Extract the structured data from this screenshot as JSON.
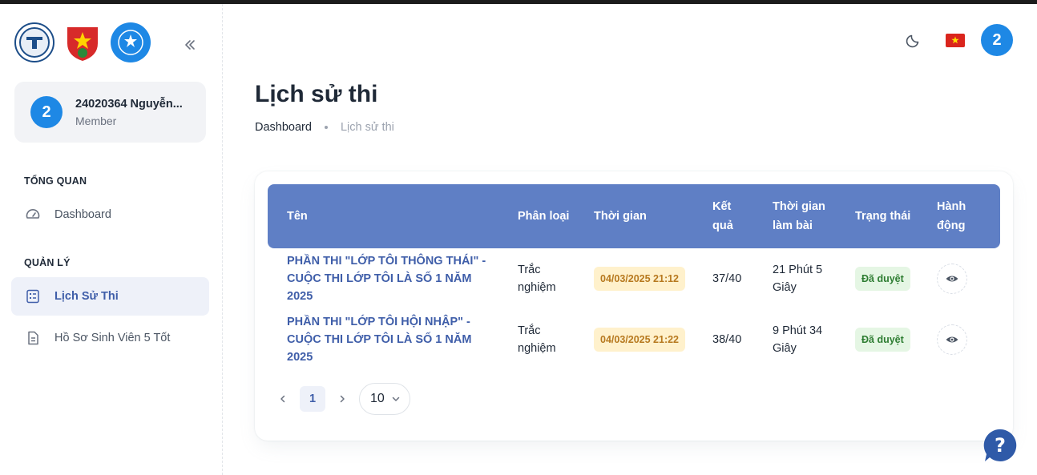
{
  "sidebar": {
    "user": {
      "avatar_letter": "2",
      "name": "24020364 Nguyễn...",
      "role": "Member"
    },
    "sections": [
      {
        "title": "TỔNG QUAN"
      },
      {
        "title": "QUẢN LÝ"
      }
    ],
    "items": [
      {
        "label": "Dashboard",
        "icon": "speedometer-icon",
        "active": false
      },
      {
        "label": "Lịch Sử Thi",
        "icon": "exam-list-icon",
        "active": true
      },
      {
        "label": "Hồ Sơ Sinh Viên 5 Tốt",
        "icon": "document-icon",
        "active": false
      }
    ]
  },
  "header": {
    "avatar_letter": "2",
    "theme_icon": "moon-icon",
    "language_flag": "vietnam-flag-icon"
  },
  "page": {
    "title": "Lịch sử thi",
    "breadcrumb": {
      "home": "Dashboard",
      "current": "Lịch sử thi"
    }
  },
  "table": {
    "headers": {
      "name": "Tên",
      "category": "Phân loại",
      "time": "Thời gian",
      "result_line1": "Kết",
      "result_line2": "quả",
      "duration_line1": "Thời gian",
      "duration_line2": "làm bài",
      "status": "Trạng thái",
      "action_line1": "Hành",
      "action_line2": "động"
    },
    "rows": [
      {
        "name": "PHẦN THI \"LỚP TÔI THÔNG THÁI\" - CUỘC THI LỚP TÔI LÀ SỐ 1 NĂM 2025",
        "category": "Trắc nghiệm",
        "time": "04/03/2025 21:12",
        "result": "37/40",
        "duration": "21 Phút 5 Giây",
        "status": "Đã duyệt"
      },
      {
        "name": "PHẦN THI \"LỚP TÔI HỘI NHẬP\" - CUỘC THI LỚP TÔI LÀ SỐ 1 NĂM 2025",
        "category": "Trắc nghiệm",
        "time": "04/03/2025 21:22",
        "result": "38/40",
        "duration": "9 Phút 34 Giây",
        "status": "Đã duyệt"
      }
    ]
  },
  "pagination": {
    "current_page": "1",
    "page_size": "10"
  },
  "colors": {
    "primary": "#3f5ea9",
    "table_header": "#5f7fc5",
    "avatar": "#1e88e5",
    "time_chip_bg": "#fff1cc",
    "time_chip_text": "#b7791f",
    "status_bg": "#e5f6e4",
    "status_text": "#2e7d32"
  }
}
